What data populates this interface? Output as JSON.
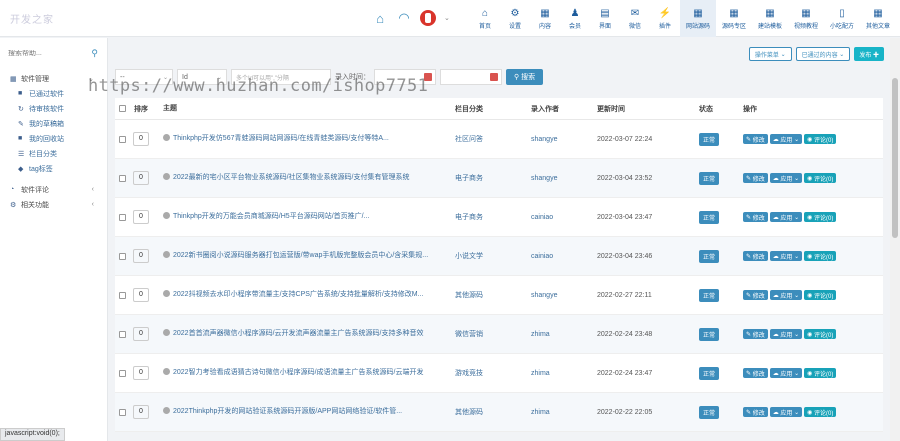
{
  "brand": {
    "logo_text": "开发之家"
  },
  "watermark": "https://www.huzhan.com/ishop7751",
  "status_url": "javascript:void(0);",
  "topnav": [
    {
      "label": "首页",
      "icon": "home-icon",
      "glyph": "⌂"
    },
    {
      "label": "设置",
      "icon": "gear-icon",
      "glyph": "⚙"
    },
    {
      "label": "内容",
      "icon": "grid-icon",
      "glyph": "▦"
    },
    {
      "label": "会员",
      "icon": "user-icon",
      "glyph": "♟"
    },
    {
      "label": "界面",
      "icon": "layout-icon",
      "glyph": "▤"
    },
    {
      "label": "微信",
      "icon": "wechat-icon",
      "glyph": "✉"
    },
    {
      "label": "插件",
      "icon": "plugin-icon",
      "glyph": "⚡"
    },
    {
      "label": "网站源码",
      "icon": "table-icon",
      "glyph": "▦"
    },
    {
      "label": "源码专区",
      "icon": "table-icon",
      "glyph": "▦"
    },
    {
      "label": "建站模板",
      "icon": "table-icon",
      "glyph": "▦"
    },
    {
      "label": "视频教程",
      "icon": "table-icon",
      "glyph": "▦"
    },
    {
      "label": "小吃配方",
      "icon": "file-icon",
      "glyph": "▯"
    },
    {
      "label": "其他文章",
      "icon": "table-icon",
      "glyph": "▦"
    }
  ],
  "sidebar": {
    "search_placeholder": "搜索帮助...",
    "items": [
      {
        "label": "软件管理",
        "icon": "grid-icon",
        "glyph": "▦",
        "sub": false,
        "arrow": "⌄"
      },
      {
        "label": "已通过软件",
        "icon": "grid-icon",
        "glyph": "■",
        "sub": true,
        "arrow": ""
      },
      {
        "label": "待审核软件",
        "icon": "refresh-icon",
        "glyph": "↻",
        "sub": true,
        "arrow": ""
      },
      {
        "label": "我的草稿箱",
        "icon": "edit-icon",
        "glyph": "✎",
        "sub": true,
        "arrow": ""
      },
      {
        "label": "我的回收站",
        "icon": "trash-icon",
        "glyph": "■",
        "sub": true,
        "arrow": ""
      },
      {
        "label": "栏目分类",
        "icon": "list-icon",
        "glyph": "☰",
        "sub": true,
        "arrow": ""
      },
      {
        "label": "tag标签",
        "icon": "tag-icon",
        "glyph": "◆",
        "sub": true,
        "arrow": ""
      },
      {
        "label": "软件评论",
        "icon": "comment-icon",
        "glyph": "◔",
        "sub": false,
        "arrow": "‹"
      },
      {
        "label": "相关功能",
        "icon": "gear-icon",
        "glyph": "⚙",
        "sub": false,
        "arrow": "‹"
      }
    ]
  },
  "actions": {
    "batch": "操作菜单",
    "filter": "已通过的内容",
    "publish": "发布 ✚"
  },
  "filters": {
    "select1": "--",
    "select2": "Id",
    "keyword_placeholder": "多个Id可以用\",\"分隔",
    "time_label": "录入时间：",
    "search_btn": "搜索"
  },
  "table": {
    "headers": {
      "order": "排序",
      "title": "主题",
      "category": "栏目分类",
      "author": "录入作者",
      "time": "更新时间",
      "status": "状态",
      "ops": "操作"
    },
    "rows": [
      {
        "order": "0",
        "title": "Thinkphp开发仿567青蛙源码网站网源码/在线青蛙类源码/支付等特A...",
        "category": "社区问答",
        "author": "shangye",
        "time": "2022-03-07 22:24",
        "status": "正常",
        "edit": "修改",
        "apply": "应用",
        "comment": "评论(0)"
      },
      {
        "order": "0",
        "title": "2022最新的宅小区平台物业系统源码/社区集物业系统源码/支付集有管理系统",
        "category": "电子商务",
        "author": "shangye",
        "time": "2022-03-04 23:52",
        "status": "正常",
        "edit": "修改",
        "apply": "应用",
        "comment": "评论(0)"
      },
      {
        "order": "0",
        "title": "Thinkphp开发的万能会员商城源码/H5平台源码网站/首页推广/...",
        "category": "电子商务",
        "author": "cainiao",
        "time": "2022-03-04 23:47",
        "status": "正常",
        "edit": "修改",
        "apply": "应用",
        "comment": "评论(0)"
      },
      {
        "order": "0",
        "title": "2022新书圈阅小说源码服务器打包运营版/带wap手机版完整版会员中心/含采集规...",
        "category": "小说文学",
        "author": "cainiao",
        "time": "2022-03-04 23:46",
        "status": "正常",
        "edit": "修改",
        "apply": "应用",
        "comment": "评论(0)"
      },
      {
        "order": "0",
        "title": "2022抖视频去水印小程序带流量主/支持CPS广告系统/支持批量解析/支持修改M...",
        "category": "其他源码",
        "author": "shangye",
        "time": "2022-02-27 22:11",
        "status": "正常",
        "edit": "修改",
        "apply": "应用",
        "comment": "评论(0)"
      },
      {
        "order": "0",
        "title": "2022首首流声器微信小程序源码/云开发流声器流量主广告系统源码/支持多种音效",
        "category": "微信营销",
        "author": "zhima",
        "time": "2022-02-24 23:48",
        "status": "正常",
        "edit": "修改",
        "apply": "应用",
        "comment": "评论(0)"
      },
      {
        "order": "0",
        "title": "2022智力考验看成语猜古诗句微信小程序源码/成语流量主广告系统源码/云端开发",
        "category": "游戏竞技",
        "author": "zhima",
        "time": "2022-02-24 23:47",
        "status": "正常",
        "edit": "修改",
        "apply": "应用",
        "comment": "评论(0)"
      },
      {
        "order": "0",
        "title": "2022Thinkphp开发的网站验证系统源码开源版/APP网站网络验证/软件管...",
        "category": "其他源码",
        "author": "zhima",
        "time": "2022-02-22 22:05",
        "status": "正常",
        "edit": "修改",
        "apply": "应用",
        "comment": "评论(0)"
      }
    ]
  }
}
